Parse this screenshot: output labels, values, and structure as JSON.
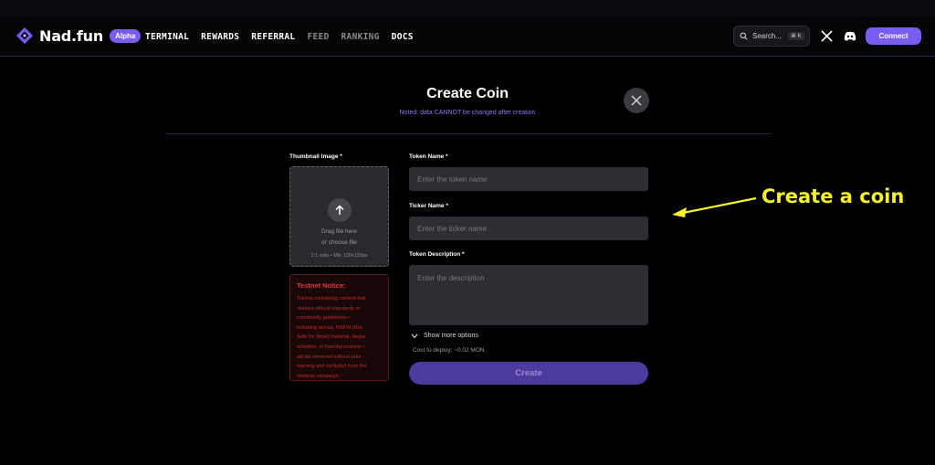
{
  "brand": {
    "name": "Nad.fun",
    "badge": "Alpha",
    "accent": "#7b5cf0"
  },
  "nav": [
    {
      "label": "TERMINAL",
      "active": true
    },
    {
      "label": "REWARDS",
      "active": true
    },
    {
      "label": "REFERRAL",
      "active": true
    },
    {
      "label": "FEED",
      "active": false
    },
    {
      "label": "RANKING",
      "active": false
    },
    {
      "label": "DOCS",
      "active": true
    }
  ],
  "search": {
    "placeholder": "Search...",
    "shortcut": "⌘ K"
  },
  "header_icons": [
    "x-icon",
    "discord-icon"
  ],
  "connect_label": "Connect",
  "modal": {
    "title": "Create Coin",
    "subtitle": "Noted: data CANNOT be changed after creation",
    "thumbnail": {
      "label": "Thumbnail Image *",
      "line1": "Drag file here",
      "line2": "or choose file",
      "hint": "1:1 ratio • Min 130x130px"
    },
    "notice": {
      "title": "Testnet Notice:",
      "lines": [
        "Tokens containing content that",
        "violates ethical standards or",
        "community guidelines—",
        "including sexual, NSFW (Not",
        "Safe for Work) material, illegal",
        "activities, or harmful content—",
        "will be removed without prior",
        "warning and excluded from the",
        "rewards campaign."
      ]
    },
    "token_name": {
      "label": "Token Name *",
      "placeholder": "Enter the token name"
    },
    "ticker_name": {
      "label": "Ticker Name *",
      "placeholder": "Enter the ticker name"
    },
    "description": {
      "label": "Token Description *",
      "placeholder": "Enter the description"
    },
    "more_options": "Show more options",
    "cost": "Cost to deploy: ~0.02 MON",
    "create_label": "Create"
  },
  "annotation": {
    "text": "Create a coin",
    "color": "#f7f32a"
  }
}
